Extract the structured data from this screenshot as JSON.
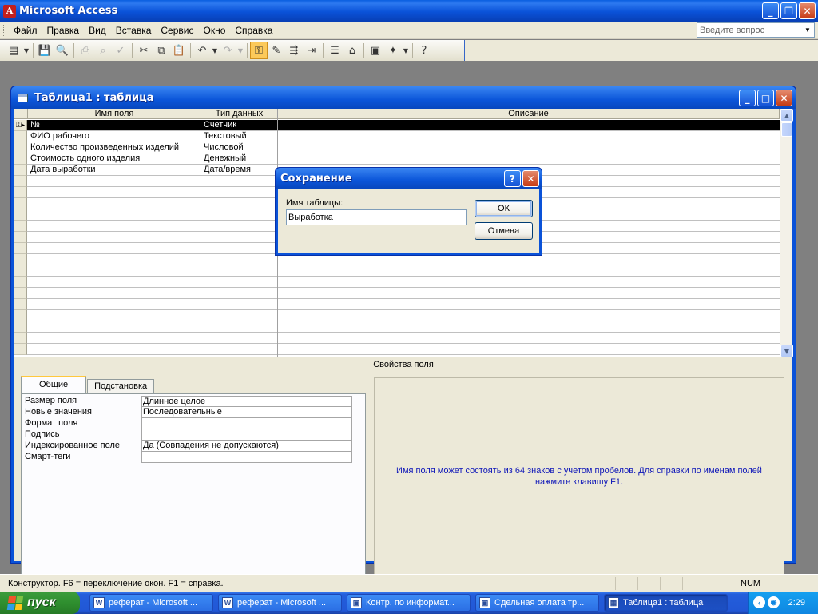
{
  "app": {
    "title": "Microsoft Access",
    "icon": "access-icon"
  },
  "menu": {
    "items": [
      "Файл",
      "Правка",
      "Вид",
      "Вставка",
      "Сервис",
      "Окно",
      "Справка"
    ],
    "ask_placeholder": "Введите вопрос"
  },
  "toolbar": {
    "icons": [
      "view-icon",
      "save-icon",
      "search-icon",
      "print-icon",
      "print-preview-icon",
      "spelling-icon",
      "cut-icon",
      "copy-icon",
      "paste-icon",
      "undo-icon",
      "redo-icon",
      "primary-key-icon",
      "build-icon",
      "insert-rows-icon",
      "delete-rows-icon",
      "properties-icon",
      "build-expression-icon",
      "database-window-icon",
      "new-object-icon",
      "help-icon"
    ]
  },
  "child_window": {
    "title": "Таблица1 : таблица",
    "columns": [
      "Имя поля",
      "Тип данных",
      "Описание"
    ],
    "rows": [
      {
        "name": "№",
        "type": "Счетчик",
        "desc": ""
      },
      {
        "name": "ФИО рабочего",
        "type": "Текстовый",
        "desc": ""
      },
      {
        "name": "Количество произведенных изделий",
        "type": "Числовой",
        "desc": ""
      },
      {
        "name": "Стоимость одного изделия",
        "type": "Денежный",
        "desc": ""
      },
      {
        "name": "Дата выработки",
        "type": "Дата/время",
        "desc": ""
      }
    ],
    "properties_title": "Свойства поля",
    "tabs": [
      "Общие",
      "Подстановка"
    ],
    "properties": [
      {
        "label": "Размер поля",
        "value": "Длинное целое"
      },
      {
        "label": "Новые значения",
        "value": "Последовательные"
      },
      {
        "label": "Формат поля",
        "value": ""
      },
      {
        "label": "Подпись",
        "value": ""
      },
      {
        "label": "Индексированное поле",
        "value": "Да (Совпадения не допускаются)"
      },
      {
        "label": "Смарт-теги",
        "value": ""
      }
    ],
    "help_text": "Имя поля может состоять из 64 знаков с учетом пробелов.  Для справки по именам полей нажмите клавишу F1."
  },
  "dialog": {
    "title": "Сохранение",
    "label": "Имя таблицы:",
    "value": "Выработка",
    "ok": "ОК",
    "cancel": "Отмена"
  },
  "statusbar": {
    "text": "Конструктор.  F6 = переключение окон.  F1 = справка.",
    "num": "NUM"
  },
  "taskbar": {
    "start": "пуск",
    "tasks": [
      {
        "label": "реферат - Microsoft ...",
        "icon": "W",
        "active": false
      },
      {
        "label": "реферат - Microsoft ...",
        "icon": "W",
        "active": false
      },
      {
        "label": "Контр. по информат...",
        "icon": "▣",
        "active": false
      },
      {
        "label": "Сдельная оплата тр...",
        "icon": "▣",
        "active": false
      },
      {
        "label": "Таблица1 : таблица",
        "icon": "▦",
        "active": true
      }
    ],
    "clock": "2:29"
  }
}
